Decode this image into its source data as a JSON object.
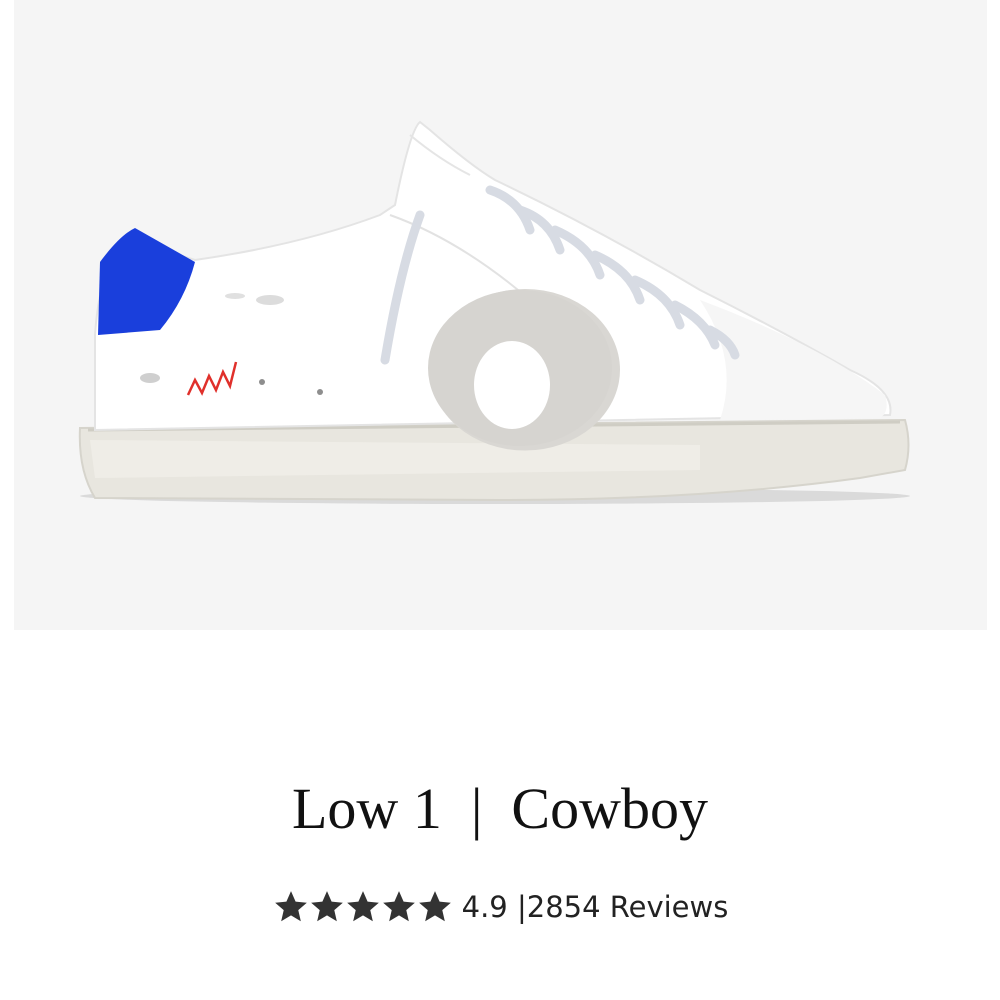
{
  "product": {
    "title": "Low 1  |  Cowboy",
    "image_alt": "White leather low-top sneaker with blue heel tab",
    "colors": {
      "background": "#f5f5f5",
      "heel_tab": "#1a3fdc",
      "stitch_accent": "#e0302b",
      "text": "#111111",
      "star": "#333333"
    }
  },
  "rating": {
    "value": "4.9",
    "stars_filled": 5,
    "stars_total": 5,
    "separator": "|",
    "review_count": "2854",
    "review_label": "Reviews",
    "summary_text": "4.9 |2854 Reviews",
    "star_icon": "star-icon"
  }
}
